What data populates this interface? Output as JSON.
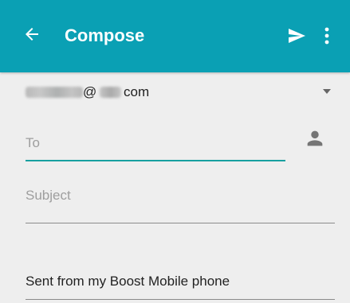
{
  "colors": {
    "toolbar_background": "#0aa0b4",
    "page_background": "#eeeeee",
    "accent_underline": "#17a0a0"
  },
  "toolbar": {
    "title": "Compose",
    "icons": {
      "back": "back-arrow-icon",
      "send": "send-icon",
      "more": "more-vert-icon"
    }
  },
  "from": {
    "at_sign": "@",
    "domain": "com",
    "icons": {
      "dropdown": "dropdown-caret-icon"
    }
  },
  "to_field": {
    "placeholder": "To",
    "icons": {
      "contact": "person-icon"
    }
  },
  "subject_field": {
    "placeholder": "Subject"
  },
  "body": {
    "signature": "Sent from my Boost Mobile phone"
  }
}
